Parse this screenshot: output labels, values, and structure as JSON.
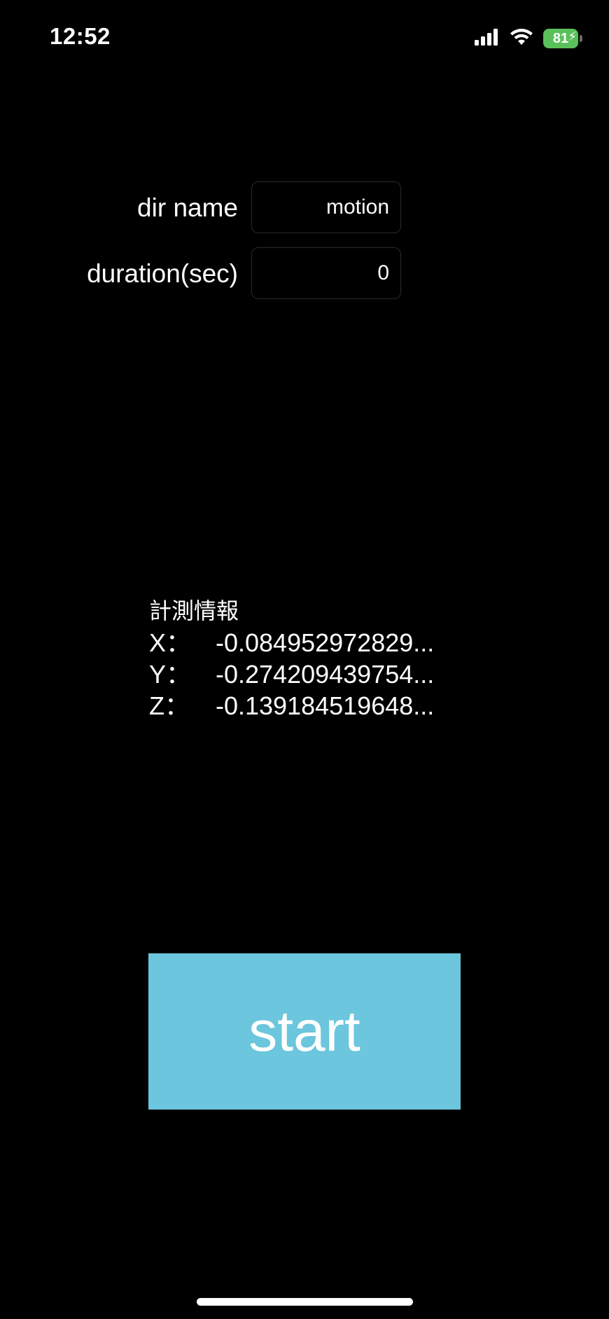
{
  "status_bar": {
    "time": "12:52",
    "battery_level": "81",
    "battery_color": "#5ac05a",
    "icons": [
      "cellular-signal-icon",
      "wifi-icon",
      "battery-icon",
      "charging-bolt-icon"
    ]
  },
  "form": {
    "dir_name_label": "dir name",
    "dir_name_value": "motion",
    "duration_label": "duration(sec)",
    "duration_value": "0"
  },
  "measurement": {
    "title": "計測情報",
    "rows": [
      {
        "key": "X：",
        "value": "-0.084952972829..."
      },
      {
        "key": "Y：",
        "value": "-0.274209439754..."
      },
      {
        "key": "Z：",
        "value": "-0.139184519648..."
      }
    ]
  },
  "start_button": {
    "label": "start",
    "color": "#6cc6dd"
  }
}
